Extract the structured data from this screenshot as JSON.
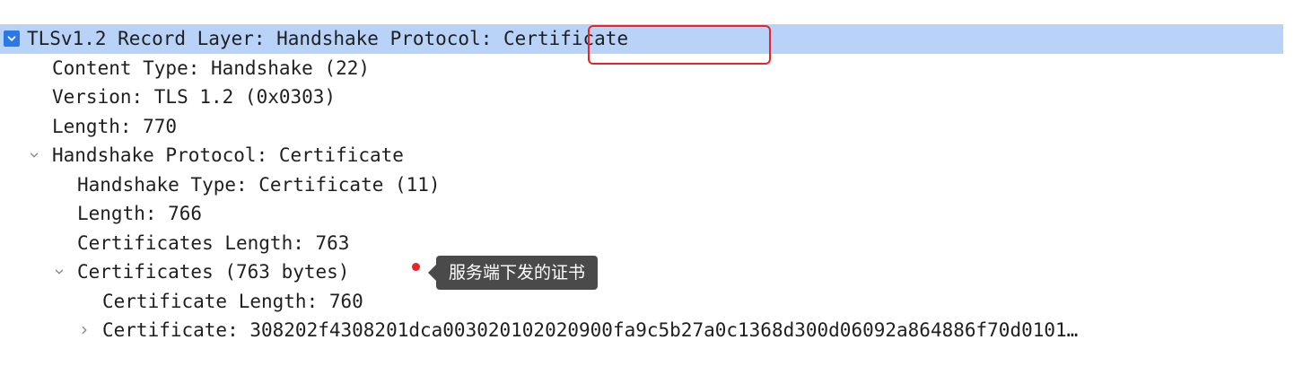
{
  "tree": {
    "record_layer": {
      "label": "TLSv1.2 Record Layer: Handshake Protocol: Certificate",
      "expanded": true,
      "selected": true
    },
    "content_type": "Content Type: Handshake (22)",
    "version": "Version: TLS 1.2 (0x0303)",
    "record_length": "Length: 770",
    "handshake_protocol": {
      "label": "Handshake Protocol: Certificate",
      "expanded": true
    },
    "handshake_type": "Handshake Type: Certificate (11)",
    "handshake_length": "Length: 766",
    "certificates_length": "Certificates Length: 763",
    "certificates": {
      "label": "Certificates (763 bytes)",
      "expanded": true
    },
    "certificate_length": "Certificate Length: 760",
    "certificate": {
      "label": "Certificate: 308202f4308201dca003020102020900fa9c5b27a0c1368d300d06092a864886f70d0101…",
      "expanded": false
    }
  },
  "annotation": {
    "tooltip": "服务端下发的证书"
  },
  "colors": {
    "selection": "#b8d3f7",
    "toggle_active": "#2b79e4",
    "highlight": "#e8232a",
    "tooltip_bg": "#4a4a4a"
  },
  "icons": {
    "expanded": "chevron-down-icon",
    "collapsed": "chevron-right-icon"
  }
}
